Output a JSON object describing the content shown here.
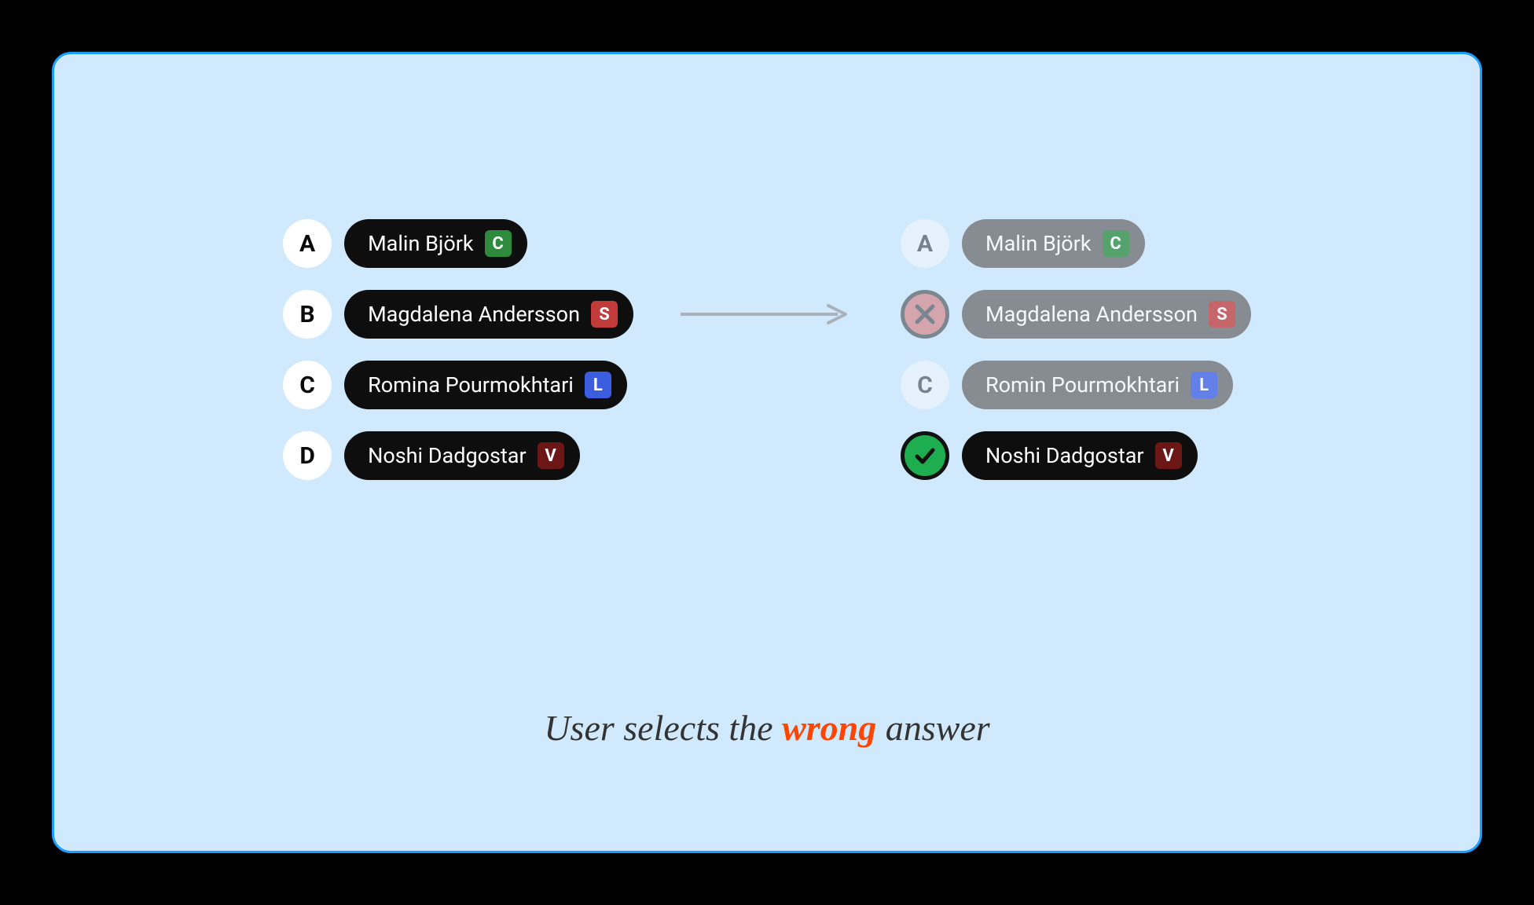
{
  "left": {
    "options": [
      {
        "letter": "A",
        "name": "Malin Björk",
        "party": "C",
        "partyColor": "#2e8b3d"
      },
      {
        "letter": "B",
        "name": "Magdalena Andersson",
        "party": "S",
        "partyColor": "#c13b3b"
      },
      {
        "letter": "C",
        "name": "Romina Pourmokhtari",
        "party": "L",
        "partyColor": "#3d5de0"
      },
      {
        "letter": "D",
        "name": "Noshi Dadgostar",
        "party": "V",
        "partyColor": "#6d1616"
      }
    ]
  },
  "right": {
    "options": [
      {
        "letter": "A",
        "name": "Malin Björk",
        "party": "C",
        "partyColor": "#2e8b3d",
        "state": "faded"
      },
      {
        "letter": "",
        "name": "Magdalena Andersson",
        "party": "S",
        "partyColor": "#c13b3b",
        "state": "wrong"
      },
      {
        "letter": "C",
        "name": "Romin Pourmokhtari",
        "party": "L",
        "partyColor": "#3d5de0",
        "state": "faded"
      },
      {
        "letter": "",
        "name": "Noshi Dadgostar",
        "party": "V",
        "partyColor": "#6d1616",
        "state": "correct"
      }
    ]
  },
  "caption": {
    "before": "User selects the ",
    "emph": "wrong",
    "after": " answer"
  }
}
